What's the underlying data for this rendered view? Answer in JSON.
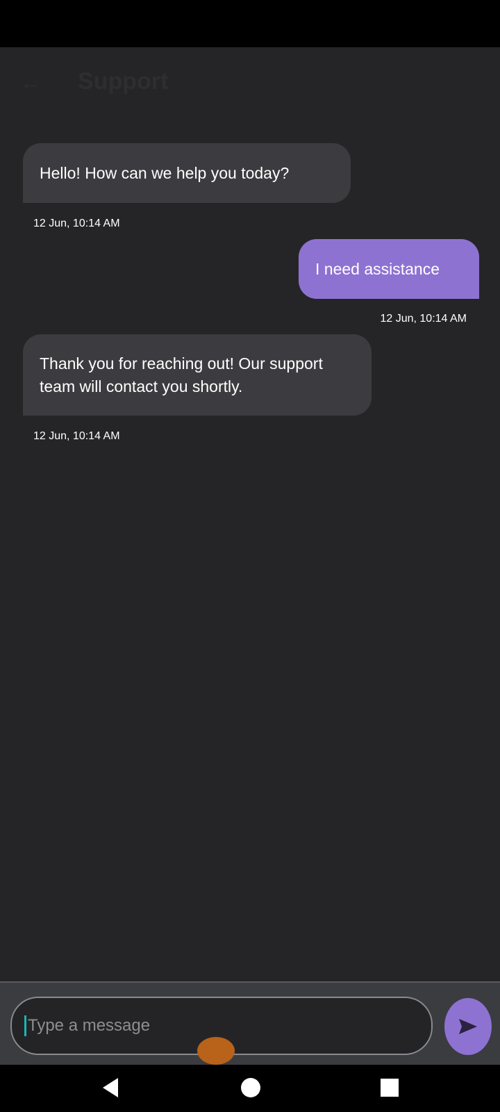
{
  "header": {
    "title": "Support",
    "back_icon": "arrow-left-icon"
  },
  "messages": [
    {
      "sender": "support",
      "text": "Hello! How can we help you today?",
      "time": "12 Jun, 10:14 AM"
    },
    {
      "sender": "user",
      "text": "I need assistance",
      "time": "12 Jun, 10:14 AM"
    },
    {
      "sender": "support",
      "text": "Thank you for reaching out! Our support team will contact you shortly.",
      "time": "12 Jun, 10:14 AM"
    }
  ],
  "composer": {
    "placeholder": "Type a message",
    "send_icon": "send-icon"
  },
  "colors": {
    "accent": "#8e72d2",
    "background": "#252528",
    "incoming_bubble": "#3c3c40"
  }
}
